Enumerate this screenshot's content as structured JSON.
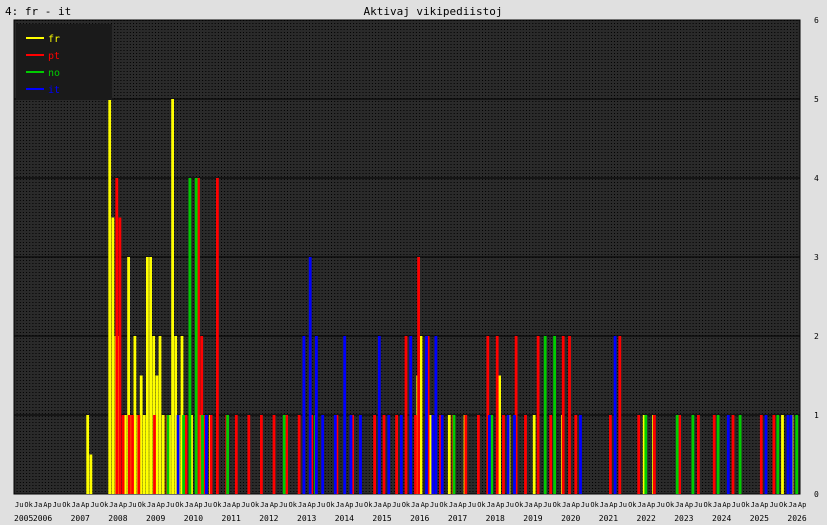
{
  "header": {
    "left_label": "4: fr - it",
    "title": "Aktivaj vikipediistoj"
  },
  "colors": {
    "page_bg": "#e0e0e0",
    "plot_bg": "#2a2a2a",
    "grid": "#000000",
    "legend_bg": "#1a1a1a",
    "fr": "#ffff00",
    "pt": "#ff0000",
    "no": "#00cc00",
    "it": "#0000ff"
  },
  "chart_data": {
    "type": "bar",
    "title": "Aktivaj vikipediistoj",
    "xlabel": "",
    "ylabel": "",
    "ylim": [
      0,
      6
    ],
    "y_ticks": [
      "0",
      "1",
      "2",
      "3",
      "4",
      "5",
      "6"
    ],
    "x_range_months": [
      "2005-07",
      "2026-04"
    ],
    "year_labels": [
      "2005",
      "2006",
      "2007",
      "2008",
      "2009",
      "2010",
      "2011",
      "2012",
      "2013",
      "2014",
      "2015",
      "2016",
      "2017",
      "2018",
      "2019",
      "2020",
      "2021",
      "2022",
      "2023",
      "2024",
      "2025",
      "2026"
    ],
    "month_tick_labels": [
      "Ju",
      "Ok",
      "Ja",
      "Ap"
    ],
    "legend": [
      "fr",
      "pt",
      "no",
      "it"
    ],
    "legend_placement": "top-left",
    "series": [
      {
        "name": "fr",
        "color": "#ffff00",
        "points": [
          [
            "2007-06",
            1
          ],
          [
            "2007-07",
            0.5
          ],
          [
            "2008-01",
            5
          ],
          [
            "2008-02",
            3.5
          ],
          [
            "2008-03",
            2
          ],
          [
            "2008-04",
            2
          ],
          [
            "2008-06",
            1
          ],
          [
            "2008-07",
            3
          ],
          [
            "2008-08",
            1
          ],
          [
            "2008-09",
            2
          ],
          [
            "2008-10",
            1
          ],
          [
            "2008-11",
            1.5
          ],
          [
            "2008-12",
            1
          ],
          [
            "2009-01",
            3
          ],
          [
            "2009-02",
            3
          ],
          [
            "2009-03",
            2
          ],
          [
            "2009-04",
            1.5
          ],
          [
            "2009-05",
            2
          ],
          [
            "2009-06",
            1
          ],
          [
            "2009-08",
            1
          ],
          [
            "2009-09",
            5
          ],
          [
            "2009-10",
            2
          ],
          [
            "2009-11",
            1
          ],
          [
            "2009-12",
            2
          ],
          [
            "2010-01",
            1
          ],
          [
            "2010-03",
            1
          ],
          [
            "2010-06",
            1
          ],
          [
            "2010-09",
            1
          ],
          [
            "2016-03",
            1.5
          ],
          [
            "2016-04",
            2
          ],
          [
            "2016-07",
            1
          ],
          [
            "2017-01",
            1
          ],
          [
            "2017-06",
            1
          ],
          [
            "2018-05",
            1.5
          ],
          [
            "2018-08",
            1
          ],
          [
            "2019-04",
            1
          ],
          [
            "2020-01",
            1
          ],
          [
            "2022-03",
            1
          ],
          [
            "2022-06",
            1
          ],
          [
            "2023-02",
            1
          ],
          [
            "2025-11",
            1
          ],
          [
            "2026-02",
            1
          ]
        ]
      },
      {
        "name": "pt",
        "color": "#ff0000",
        "points": [
          [
            "2008-03",
            4
          ],
          [
            "2008-04",
            3.5
          ],
          [
            "2008-05",
            1
          ],
          [
            "2008-07",
            1
          ],
          [
            "2008-08",
            1
          ],
          [
            "2008-10",
            1
          ],
          [
            "2009-03",
            1
          ],
          [
            "2009-07",
            1
          ],
          [
            "2010-01",
            1
          ],
          [
            "2010-05",
            4
          ],
          [
            "2010-06",
            2
          ],
          [
            "2010-07",
            1
          ],
          [
            "2010-09",
            1
          ],
          [
            "2010-11",
            4
          ],
          [
            "2011-02",
            1
          ],
          [
            "2011-05",
            1
          ],
          [
            "2011-09",
            1
          ],
          [
            "2012-01",
            1
          ],
          [
            "2012-05",
            1
          ],
          [
            "2012-09",
            1
          ],
          [
            "2013-01",
            1
          ],
          [
            "2013-05",
            1
          ],
          [
            "2014-01",
            1
          ],
          [
            "2014-06",
            1
          ],
          [
            "2015-01",
            1
          ],
          [
            "2015-04",
            1
          ],
          [
            "2015-08",
            1
          ],
          [
            "2015-11",
            2
          ],
          [
            "2016-02",
            1
          ],
          [
            "2016-03",
            3
          ],
          [
            "2016-06",
            2
          ],
          [
            "2016-10",
            1
          ],
          [
            "2017-02",
            1
          ],
          [
            "2017-06",
            1
          ],
          [
            "2017-10",
            1
          ],
          [
            "2018-01",
            2
          ],
          [
            "2018-04",
            2
          ],
          [
            "2018-06",
            1
          ],
          [
            "2018-10",
            2
          ],
          [
            "2019-01",
            1
          ],
          [
            "2019-05",
            2
          ],
          [
            "2019-09",
            1
          ],
          [
            "2020-01",
            2
          ],
          [
            "2020-03",
            2
          ],
          [
            "2020-05",
            1
          ],
          [
            "2021-04",
            1
          ],
          [
            "2021-07",
            2
          ],
          [
            "2022-01",
            1
          ],
          [
            "2022-06",
            1
          ],
          [
            "2023-02",
            1
          ],
          [
            "2023-08",
            1
          ],
          [
            "2024-01",
            1
          ],
          [
            "2024-07",
            1
          ],
          [
            "2025-04",
            1
          ],
          [
            "2025-08",
            1
          ]
        ]
      },
      {
        "name": "no",
        "color": "#00cc00",
        "points": [
          [
            "2009-07",
            1
          ],
          [
            "2009-12",
            1
          ],
          [
            "2010-02",
            4
          ],
          [
            "2010-04",
            4
          ],
          [
            "2010-06",
            1
          ],
          [
            "2011-02",
            1
          ],
          [
            "2012-08",
            1
          ],
          [
            "2013-06",
            1
          ],
          [
            "2017-02",
            1
          ],
          [
            "2018-02",
            1
          ],
          [
            "2019-07",
            2
          ],
          [
            "2019-10",
            2
          ],
          [
            "2022-03",
            1
          ],
          [
            "2023-01",
            1
          ],
          [
            "2023-06",
            1
          ],
          [
            "2024-02",
            1
          ],
          [
            "2024-09",
            1
          ],
          [
            "2025-09",
            1
          ],
          [
            "2026-03",
            1
          ]
        ]
      },
      {
        "name": "it",
        "color": "#0000ff",
        "points": [
          [
            "2009-10",
            1
          ],
          [
            "2010-07",
            1
          ],
          [
            "2013-02",
            2
          ],
          [
            "2013-04",
            3
          ],
          [
            "2013-06",
            2
          ],
          [
            "2013-08",
            1
          ],
          [
            "2013-12",
            1
          ],
          [
            "2014-03",
            2
          ],
          [
            "2014-05",
            1
          ],
          [
            "2014-08",
            1
          ],
          [
            "2015-02",
            2
          ],
          [
            "2015-05",
            1
          ],
          [
            "2015-09",
            1
          ],
          [
            "2015-12",
            2
          ],
          [
            "2016-05",
            2
          ],
          [
            "2016-07",
            1
          ],
          [
            "2016-08",
            2
          ],
          [
            "2016-10",
            1
          ],
          [
            "2018-01",
            1
          ],
          [
            "2018-07",
            1
          ],
          [
            "2018-09",
            1
          ],
          [
            "2020-06",
            1
          ],
          [
            "2021-05",
            2
          ],
          [
            "2024-05",
            1
          ],
          [
            "2025-05",
            1
          ],
          [
            "2025-12",
            1
          ],
          [
            "2026-01",
            1
          ]
        ]
      }
    ]
  }
}
